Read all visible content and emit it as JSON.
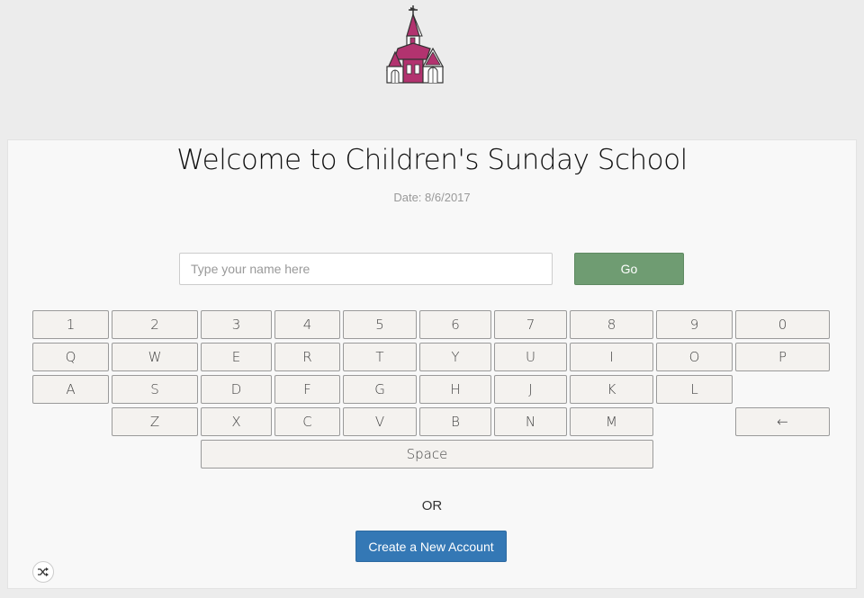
{
  "header": {
    "logo_icon": "church-icon"
  },
  "main": {
    "title": "Welcome to Children's Sunday School",
    "date": "Date: 8/6/2017",
    "name_placeholder": "Type your name here",
    "go_label": "Go",
    "or_label": "OR",
    "create_account_label": "Create a New Account",
    "shuffle_icon": "shuffle-icon"
  },
  "keyboard": {
    "row1": [
      "1",
      "2",
      "3",
      "4",
      "5",
      "6",
      "7",
      "8",
      "9",
      "0"
    ],
    "row2": [
      "Q",
      "W",
      "E",
      "R",
      "T",
      "Y",
      "U",
      "I",
      "O",
      "P"
    ],
    "row3": [
      "A",
      "S",
      "D",
      "F",
      "G",
      "H",
      "J",
      "K",
      "L"
    ],
    "row4": [
      "Z",
      "X",
      "C",
      "V",
      "B",
      "N",
      "M"
    ],
    "backspace": "←",
    "space": "Space"
  },
  "colors": {
    "go_button": "#6f9c72",
    "create_button": "#3478b5",
    "church_accent": "#b2336f"
  }
}
